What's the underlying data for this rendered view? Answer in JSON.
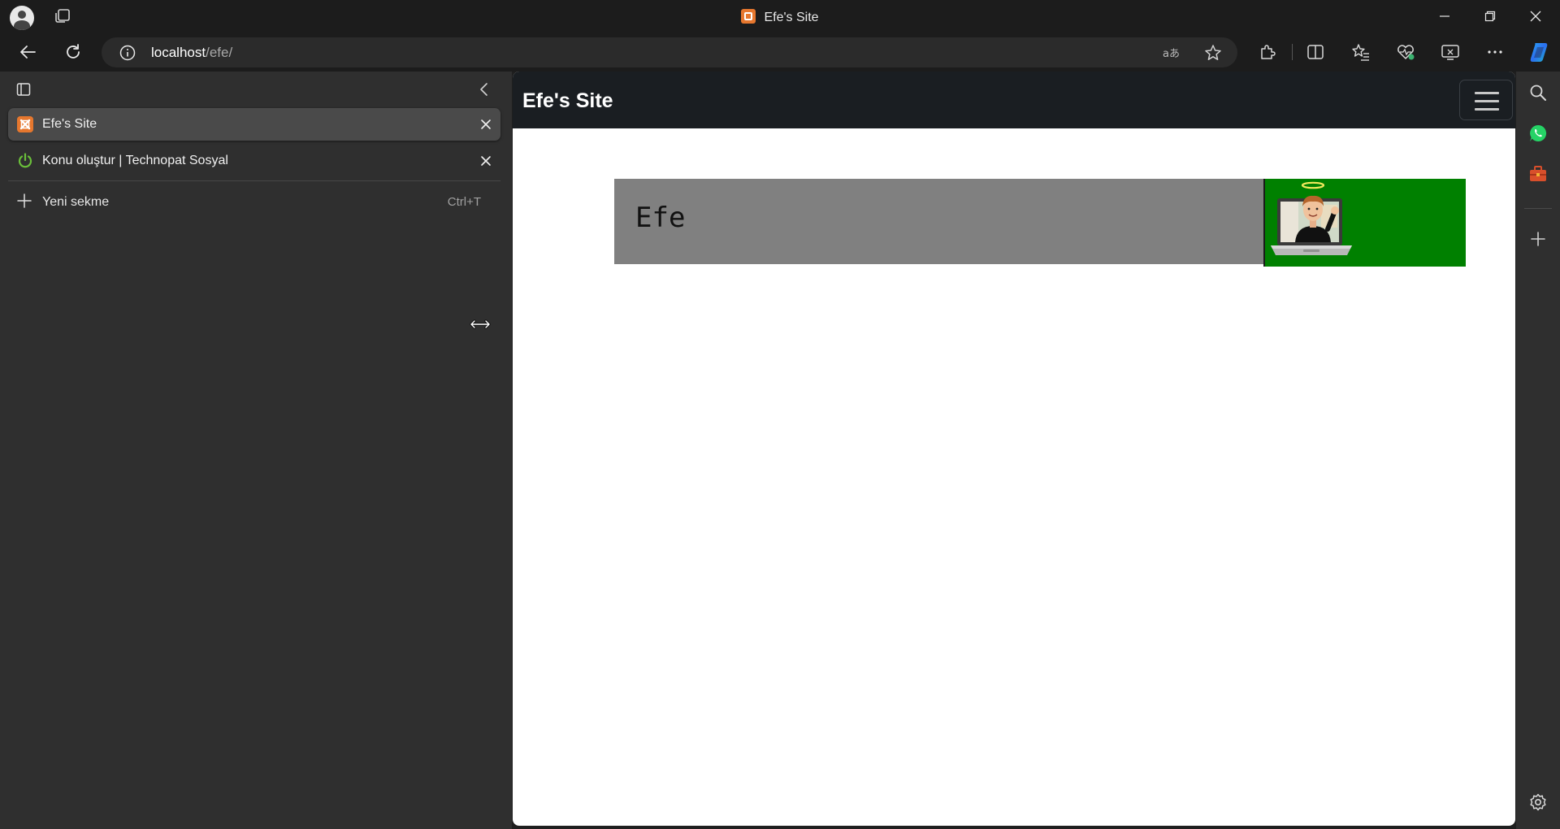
{
  "window": {
    "title": "Efe's Site",
    "controls": [
      "minimize",
      "restore",
      "close"
    ]
  },
  "address_bar": {
    "host": "localhost",
    "path": "/efe/",
    "icons": [
      "info-icon",
      "read-aloud-icon",
      "favorite-star-icon"
    ]
  },
  "toolbar": {
    "icons": [
      "extensions-icon",
      "split-screen-icon",
      "favorites-icon",
      "browser-essentials-icon",
      "screenshot-icon",
      "more-icon",
      "copilot-icon"
    ]
  },
  "vertical_tabs": {
    "tabs": [
      {
        "title": "Efe's Site",
        "active": true,
        "icon": "xampp-icon"
      },
      {
        "title": "Konu oluştur | Technopat Sosyal",
        "active": false,
        "icon": "power-icon"
      }
    ],
    "new_tab": {
      "label": "Yeni sekme",
      "shortcut": "Ctrl+T"
    }
  },
  "page": {
    "brand": "Efe's Site",
    "hero_name": "Efe",
    "colors": {
      "nav_bg": "#1a1e22",
      "hero_grey": "#808080",
      "hero_green": "#008000"
    }
  },
  "right_sidebar": {
    "icons": [
      "search-icon",
      "whatsapp-icon",
      "tools-icon",
      "add-icon",
      "settings-icon"
    ]
  }
}
